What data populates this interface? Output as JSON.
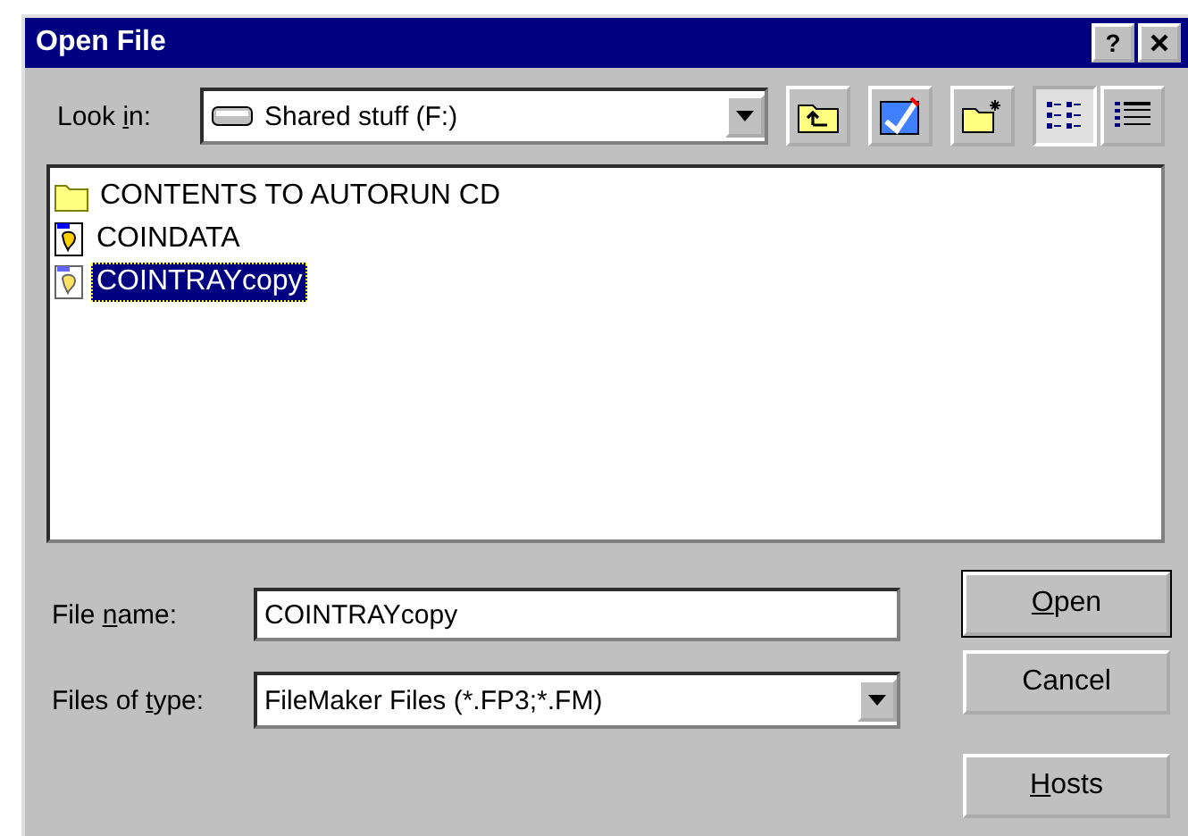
{
  "window": {
    "title": "Open File",
    "help_button": "?"
  },
  "look_in": {
    "label": {
      "before": "Look ",
      "key": "i",
      "after": "n:"
    },
    "value": "Shared stuff (F:)"
  },
  "toolbar": [
    {
      "kind": "up-folder",
      "selected": false
    },
    {
      "kind": "desktop",
      "selected": false
    },
    {
      "kind": "new-folder",
      "selected": false
    },
    {
      "kind": "list-view",
      "selected": true
    },
    {
      "kind": "details-view",
      "selected": false
    }
  ],
  "files": [
    {
      "kind": "folder",
      "name": "CONTENTS TO AUTORUN CD",
      "selected": false
    },
    {
      "kind": "document",
      "name": "COINDATA",
      "selected": false
    },
    {
      "kind": "document",
      "name": "COINTRAYcopy",
      "selected": true
    }
  ],
  "file_name": {
    "label": {
      "before": "File ",
      "key": "n",
      "after": "ame:"
    },
    "value": "COINTRAYcopy"
  },
  "file_type": {
    "label": {
      "before": "Files of ",
      "key": "t",
      "after": "ype:"
    },
    "value": "FileMaker Files (*.FP3;*.FM)"
  },
  "buttons": [
    {
      "label": {
        "key": "O",
        "after": "pen"
      },
      "default": true
    },
    {
      "label": {
        "before": "Cancel"
      },
      "default": false
    },
    {
      "label": {
        "key": "H",
        "after": "osts"
      },
      "default": false
    }
  ]
}
